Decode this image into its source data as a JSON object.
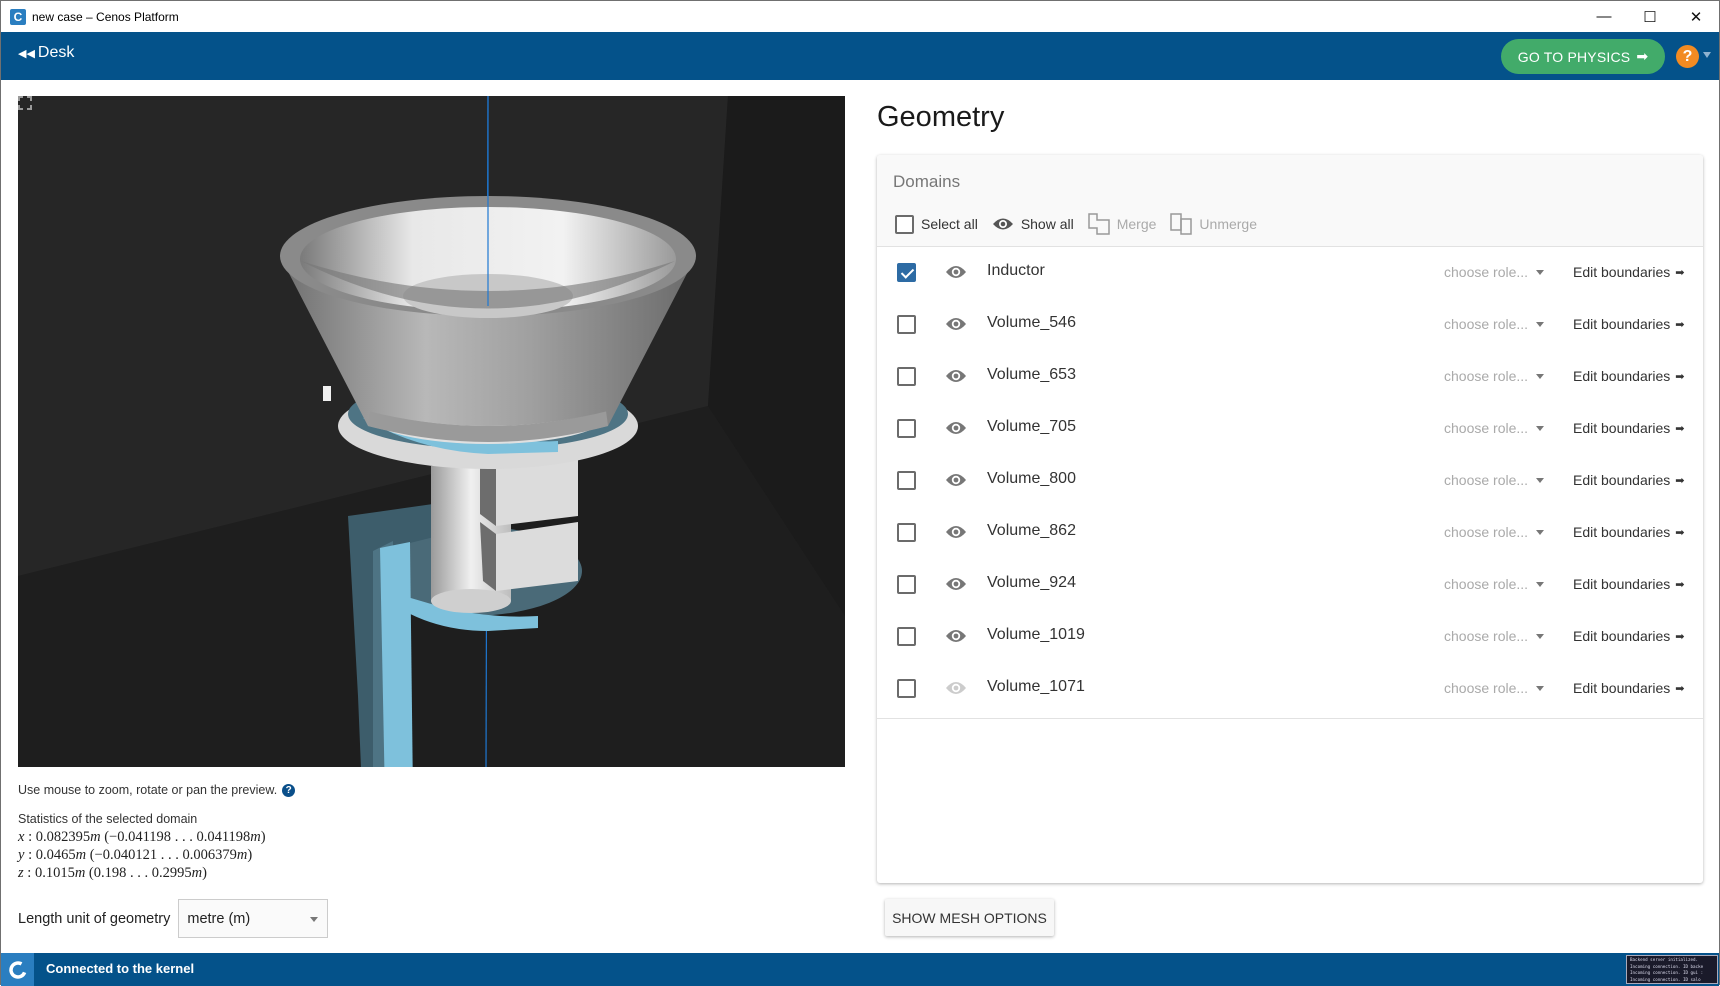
{
  "window": {
    "title": "new case – Cenos Platform",
    "app_icon": "cenos-logo-icon",
    "controls": {
      "minimize": "—",
      "maximize": "☐",
      "close": "✕"
    }
  },
  "header": {
    "back_label": "Desk",
    "back_icon": "double-arrow-left-icon",
    "primary_button": "GO TO PHYSICS",
    "primary_button_icon": "arrow-right-icon",
    "help_label": "?",
    "colors": {
      "header_bg": "#04528a",
      "primary_btn": "#42ab6a",
      "help_btn": "#f28b22"
    }
  },
  "preview": {
    "hint": "Use mouse to zoom, rotate or pan the preview.",
    "hint_icon": "help-circle-icon",
    "fullscreen_icon": "fullscreen-icon",
    "stats_title": "Statistics of the selected domain",
    "stats": [
      {
        "axis": "x",
        "size": "0.082395",
        "unit": "m",
        "min": "−0.041198",
        "max": "0.041198"
      },
      {
        "axis": "y",
        "size": "0.0465",
        "unit": "m",
        "min": "−0.040121",
        "max": "0.006379"
      },
      {
        "axis": "z",
        "size": "0.1015",
        "unit": "m",
        "min": "0.198",
        "max": "0.2995"
      }
    ],
    "unit_label": "Length unit of geometry",
    "unit_value": "metre (m)",
    "colors": {
      "selected_domain": "#7ec1dc",
      "axis_line": "#1e78d2",
      "background": "#1e1e1e"
    }
  },
  "geometry": {
    "title": "Geometry",
    "domains_title": "Domains",
    "toolbar": {
      "select_all": "Select all",
      "show_all": "Show all",
      "merge": "Merge",
      "unmerge": "Unmerge"
    },
    "role_placeholder": "choose role...",
    "edit_label": "Edit boundaries",
    "domains": [
      {
        "name": "Inductor",
        "checked": true,
        "visible": true
      },
      {
        "name": "Volume_546",
        "checked": false,
        "visible": true
      },
      {
        "name": "Volume_653",
        "checked": false,
        "visible": true
      },
      {
        "name": "Volume_705",
        "checked": false,
        "visible": true
      },
      {
        "name": "Volume_800",
        "checked": false,
        "visible": true
      },
      {
        "name": "Volume_862",
        "checked": false,
        "visible": true
      },
      {
        "name": "Volume_924",
        "checked": false,
        "visible": true
      },
      {
        "name": "Volume_1019",
        "checked": false,
        "visible": true
      },
      {
        "name": "Volume_1071",
        "checked": false,
        "visible": false
      }
    ],
    "mesh_button": "SHOW MESH OPTIONS"
  },
  "status": {
    "text": "Connected to the kernel",
    "console_lines": [
      "Backend server initialized.",
      "Incoming connection. ID backe",
      "Incoming connection. ID gui :",
      "Incoming connection. ID salo"
    ]
  }
}
